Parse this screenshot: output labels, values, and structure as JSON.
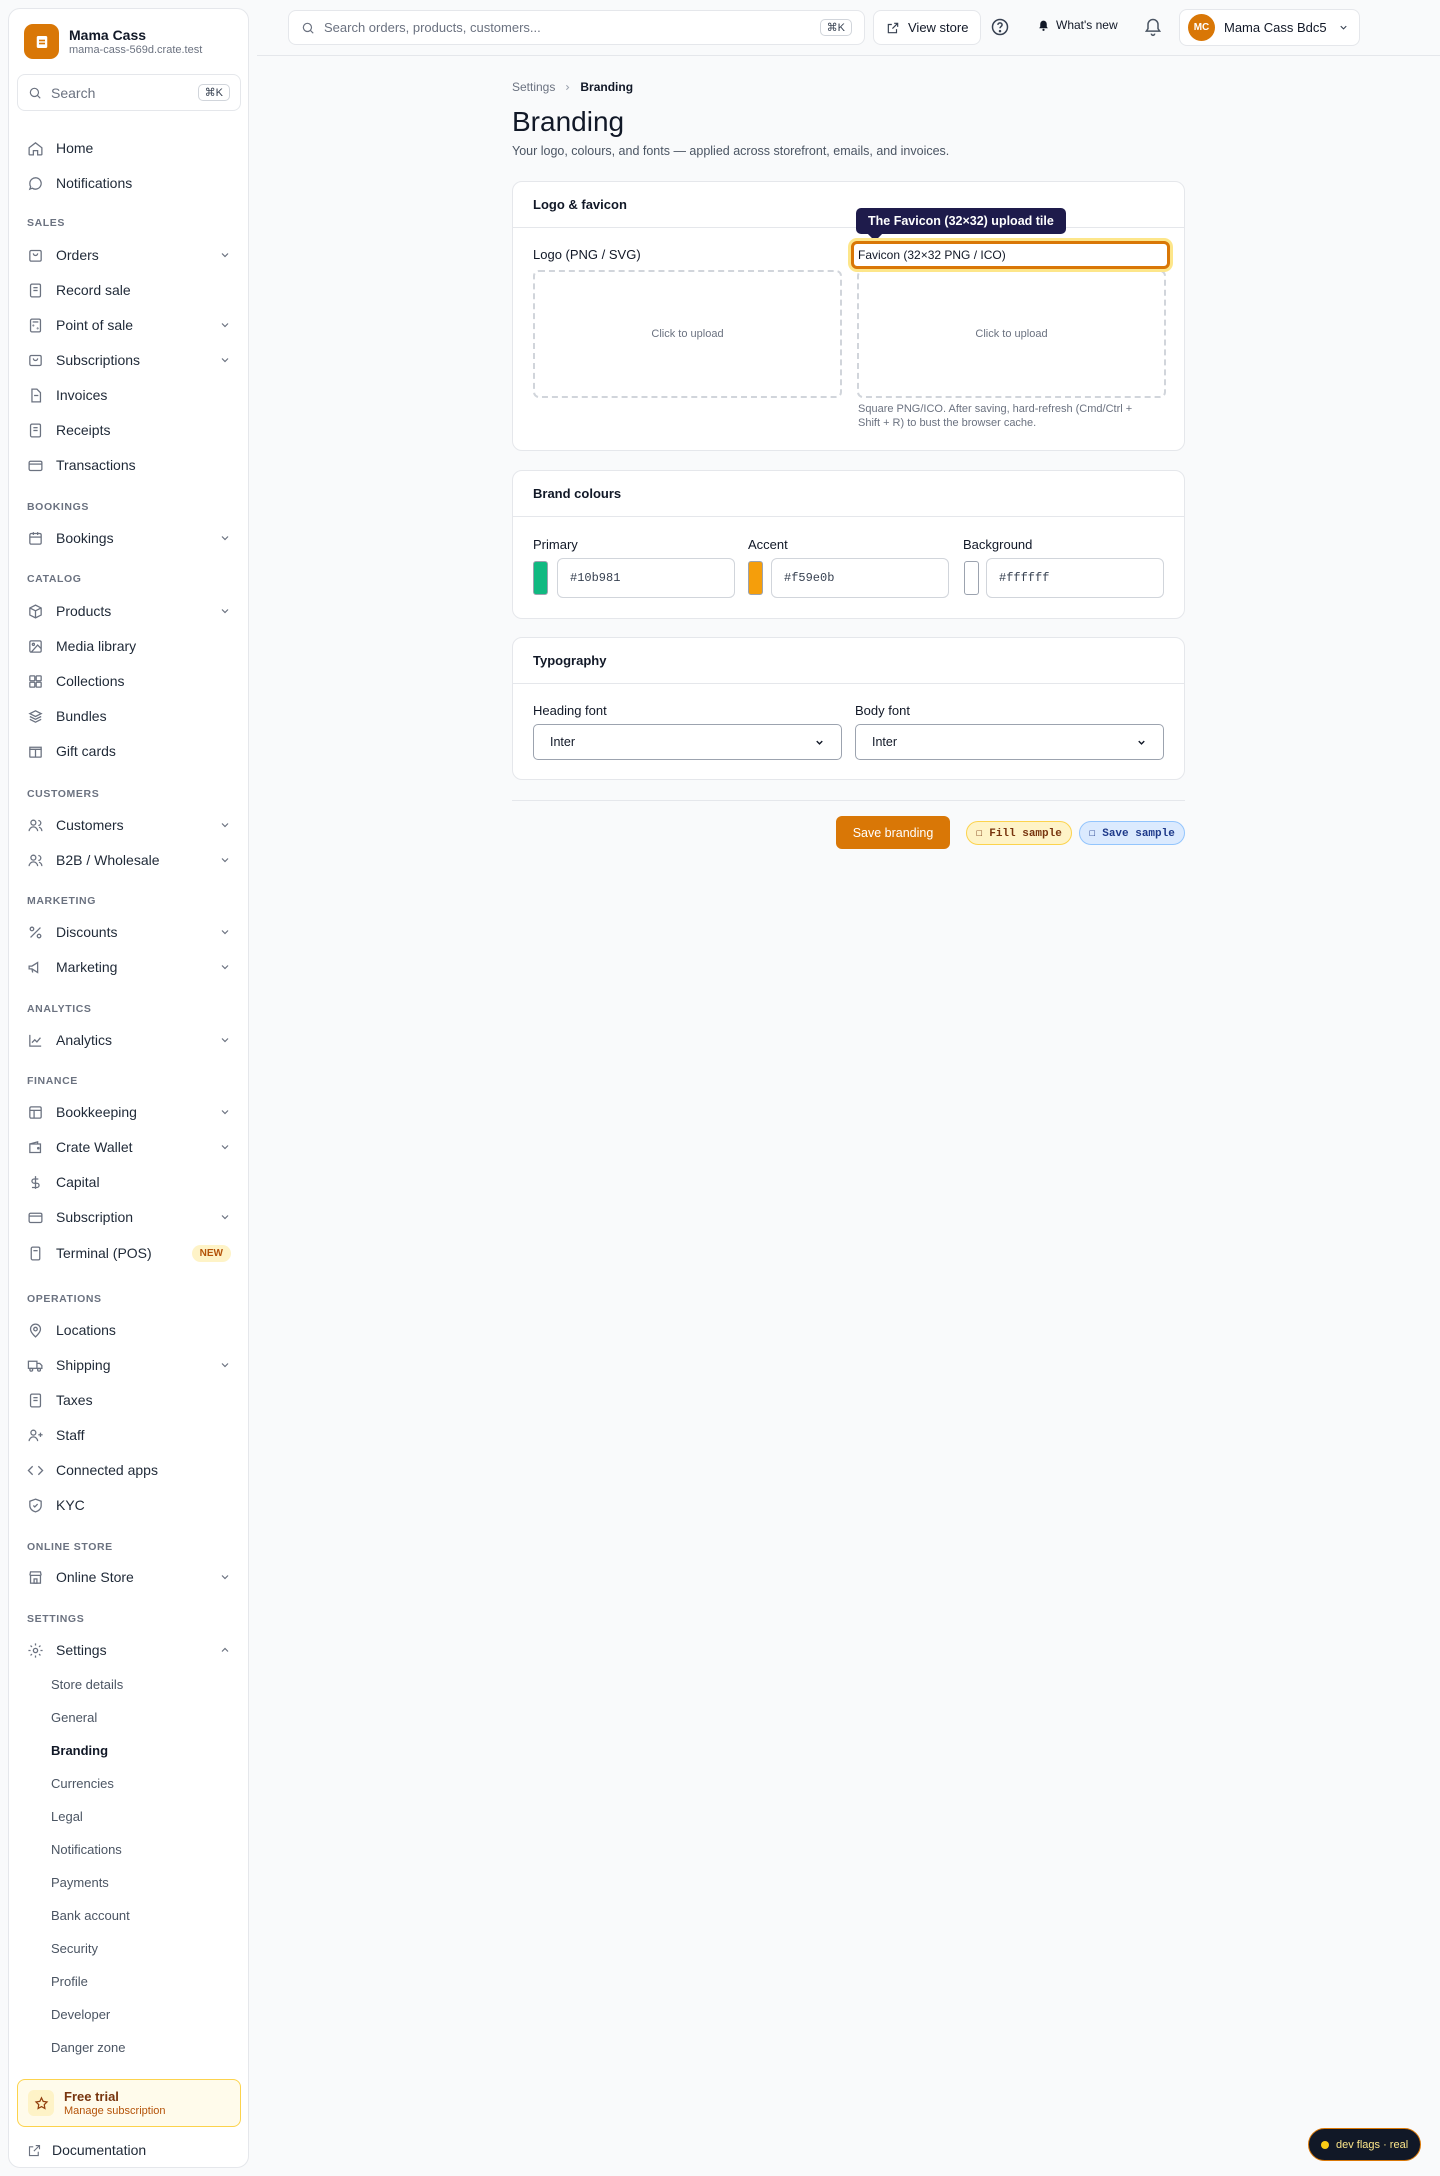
{
  "store": {
    "name": "Mama Cass",
    "domain": "mama-cass-569d.crate.test"
  },
  "sidebar": {
    "search_label": "Search",
    "search_kbd": "⌘K",
    "items": {
      "home": "Home",
      "notifications": "Notifications",
      "orders": "Orders",
      "record_sale": "Record sale",
      "pos": "Point of sale",
      "subscriptions": "Subscriptions",
      "invoices": "Invoices",
      "receipts": "Receipts",
      "transactions": "Transactions",
      "bookings": "Bookings",
      "products": "Products",
      "media": "Media library",
      "collections": "Collections",
      "bundles": "Bundles",
      "gift_cards": "Gift cards",
      "customers": "Customers",
      "b2b": "B2B / Wholesale",
      "discounts": "Discounts",
      "marketing": "Marketing",
      "analytics": "Analytics",
      "bookkeeping": "Bookkeeping",
      "wallet": "Crate Wallet",
      "capital": "Capital",
      "subscription": "Subscription",
      "terminal": "Terminal (POS)",
      "locations": "Locations",
      "shipping": "Shipping",
      "taxes": "Taxes",
      "staff": "Staff",
      "apps": "Connected apps",
      "kyc": "KYC",
      "online_store": "Online Store",
      "settings": "Settings"
    },
    "badge_new": "NEW",
    "sections": {
      "sales": "SALES",
      "bookings": "BOOKINGS",
      "catalog": "CATALOG",
      "customers": "CUSTOMERS",
      "marketing": "MARKETING",
      "analytics": "ANALYTICS",
      "finance": "FINANCE",
      "operations": "OPERATIONS",
      "online_store": "ONLINE STORE",
      "settings": "SETTINGS"
    },
    "settings_sub": {
      "store_details": "Store details",
      "general": "General",
      "branding": "Branding",
      "currencies": "Currencies",
      "legal": "Legal",
      "notifications": "Notifications",
      "payments": "Payments",
      "bank": "Bank account",
      "security": "Security",
      "profile": "Profile",
      "developer": "Developer",
      "danger": "Danger zone"
    },
    "trial": {
      "title": "Free trial",
      "sub": "Manage subscription"
    },
    "docs": "Documentation"
  },
  "topbar": {
    "search_placeholder": "Search orders, products, customers...",
    "search_kbd": "⌘K",
    "view_store": "View store",
    "whats_new": "What's new",
    "account_initials": "MC",
    "account_name": "Mama Cass Bdc5"
  },
  "breadcrumb": {
    "parent": "Settings",
    "current": "Branding"
  },
  "page": {
    "title": "Branding",
    "subtitle": "Your logo, colours, and fonts — applied across storefront, emails, and invoices."
  },
  "logo_card": {
    "title": "Logo & favicon",
    "logo_label": "Logo (PNG / SVG)",
    "logo_upload": "Click to upload",
    "favicon_label": "Favicon (32×32 PNG / ICO)",
    "favicon_upload": "Click to upload",
    "favicon_hint_1": "Square PNG/ICO. After saving, hard-refresh (Cmd/Ctrl +",
    "favicon_hint_2": "Shift + R) to bust the browser cache.",
    "tooltip": "The Favicon (32×32) upload tile"
  },
  "colours_card": {
    "title": "Brand colours",
    "primary_label": "Primary",
    "primary_value": "#10b981",
    "accent_label": "Accent",
    "accent_value": "#f59e0b",
    "background_label": "Background",
    "background_value": "#ffffff"
  },
  "typography_card": {
    "title": "Typography",
    "heading_label": "Heading font",
    "heading_value": "Inter",
    "body_label": "Body font",
    "body_value": "Inter"
  },
  "actions": {
    "save": "Save branding",
    "fill_sample": "☐ Fill sample",
    "save_sample": "☐ Save sample"
  },
  "dev_flags": "dev flags · real",
  "colors": {
    "accent": "#d97706",
    "primary": "#10b981",
    "amber": "#f59e0b",
    "white": "#ffffff"
  }
}
